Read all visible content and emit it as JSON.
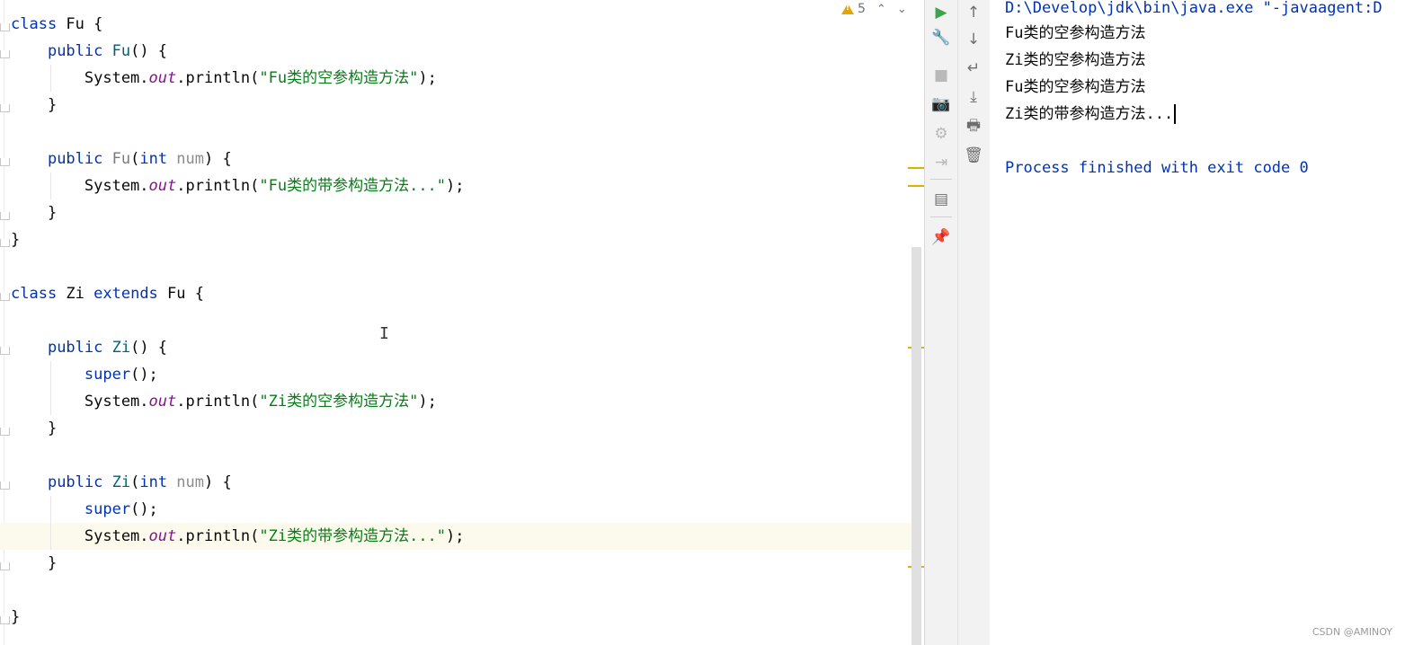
{
  "editor": {
    "lines": [
      {
        "row": 0,
        "tokens": [
          {
            "c": "kw",
            "t": "class "
          },
          {
            "c": "plain",
            "t": "Fu {"
          }
        ]
      },
      {
        "row": 1,
        "tokens": [
          {
            "c": "plain",
            "t": "    "
          },
          {
            "c": "kw",
            "t": "public "
          },
          {
            "c": "fn",
            "t": "Fu"
          },
          {
            "c": "plain",
            "t": "() {"
          }
        ]
      },
      {
        "row": 2,
        "tokens": [
          {
            "c": "plain",
            "t": "        System."
          },
          {
            "c": "field",
            "t": "out"
          },
          {
            "c": "plain",
            "t": ".println("
          },
          {
            "c": "str",
            "t": "\"Fu类的空参构造方法\""
          },
          {
            "c": "plain",
            "t": ");"
          }
        ]
      },
      {
        "row": 3,
        "tokens": [
          {
            "c": "plain",
            "t": "    }"
          }
        ]
      },
      {
        "row": 5,
        "tokens": [
          {
            "c": "plain",
            "t": "    "
          },
          {
            "c": "kw",
            "t": "public "
          },
          {
            "c": "fnd",
            "t": "Fu"
          },
          {
            "c": "plain",
            "t": "("
          },
          {
            "c": "kw",
            "t": "int "
          },
          {
            "c": "param",
            "t": "num"
          },
          {
            "c": "plain",
            "t": ") {"
          }
        ]
      },
      {
        "row": 6,
        "tokens": [
          {
            "c": "plain",
            "t": "        System."
          },
          {
            "c": "field",
            "t": "out"
          },
          {
            "c": "plain",
            "t": ".println("
          },
          {
            "c": "str",
            "t": "\"Fu类的带参构造方法...\""
          },
          {
            "c": "plain",
            "t": ");"
          }
        ]
      },
      {
        "row": 7,
        "tokens": [
          {
            "c": "plain",
            "t": "    }"
          }
        ]
      },
      {
        "row": 8,
        "tokens": [
          {
            "c": "plain",
            "t": "}"
          }
        ]
      },
      {
        "row": 10,
        "tokens": [
          {
            "c": "kw",
            "t": "class "
          },
          {
            "c": "plain",
            "t": "Zi "
          },
          {
            "c": "kw",
            "t": "extends "
          },
          {
            "c": "plain",
            "t": "Fu {"
          }
        ]
      },
      {
        "row": 12,
        "tokens": [
          {
            "c": "plain",
            "t": "    "
          },
          {
            "c": "kw",
            "t": "public "
          },
          {
            "c": "fn",
            "t": "Zi"
          },
          {
            "c": "plain",
            "t": "() {"
          }
        ]
      },
      {
        "row": 13,
        "tokens": [
          {
            "c": "plain",
            "t": "        "
          },
          {
            "c": "kw",
            "t": "super"
          },
          {
            "c": "plain",
            "t": "();"
          }
        ]
      },
      {
        "row": 14,
        "tokens": [
          {
            "c": "plain",
            "t": "        System."
          },
          {
            "c": "field",
            "t": "out"
          },
          {
            "c": "plain",
            "t": ".println("
          },
          {
            "c": "str",
            "t": "\"Zi类的空参构造方法\""
          },
          {
            "c": "plain",
            "t": ");"
          }
        ]
      },
      {
        "row": 15,
        "tokens": [
          {
            "c": "plain",
            "t": "    }"
          }
        ]
      },
      {
        "row": 17,
        "tokens": [
          {
            "c": "plain",
            "t": "    "
          },
          {
            "c": "kw",
            "t": "public "
          },
          {
            "c": "fn",
            "t": "Zi"
          },
          {
            "c": "plain",
            "t": "("
          },
          {
            "c": "kw",
            "t": "int "
          },
          {
            "c": "param",
            "t": "num"
          },
          {
            "c": "plain",
            "t": ") {"
          }
        ]
      },
      {
        "row": 18,
        "tokens": [
          {
            "c": "plain",
            "t": "        "
          },
          {
            "c": "kw",
            "t": "super"
          },
          {
            "c": "plain",
            "t": "();"
          }
        ]
      },
      {
        "row": 19,
        "tokens": [
          {
            "c": "plain",
            "t": "        System."
          },
          {
            "c": "field",
            "t": "out"
          },
          {
            "c": "plain",
            "t": ".println("
          },
          {
            "c": "str",
            "t": "\"Zi类的带参构造方法...\""
          },
          {
            "c": "plain",
            "t": ");"
          }
        ],
        "current": true
      },
      {
        "row": 20,
        "tokens": [
          {
            "c": "plain",
            "t": "    }"
          }
        ]
      },
      {
        "row": 22,
        "tokens": [
          {
            "c": "plain",
            "t": "}"
          }
        ]
      }
    ],
    "inspections": {
      "warning_count": "5",
      "up": "⌃",
      "down": "⌄"
    }
  },
  "toolbar": {
    "rerun": "▶",
    "settings": "🔧",
    "stop": "■",
    "dump": "📷",
    "debug": "⚙",
    "exit": "⇥",
    "layout": "▤",
    "pin": "📌",
    "up": "↑",
    "down": "↓",
    "wrap": "↵",
    "scroll_end": "⤓",
    "print": "🖶",
    "clear": "🗑"
  },
  "console": {
    "command": "D:\\Develop\\jdk\\bin\\java.exe \"-javaagent:D",
    "output": [
      "Fu类的空参构造方法",
      "Zi类的空参构造方法",
      "Fu类的空参构造方法",
      "Zi类的带参构造方法..."
    ],
    "finish": "Process finished with exit code 0"
  },
  "watermark": "CSDN @AMINOY",
  "colors": {
    "accent_green": "#3da44d",
    "warning": "#e5a400"
  }
}
